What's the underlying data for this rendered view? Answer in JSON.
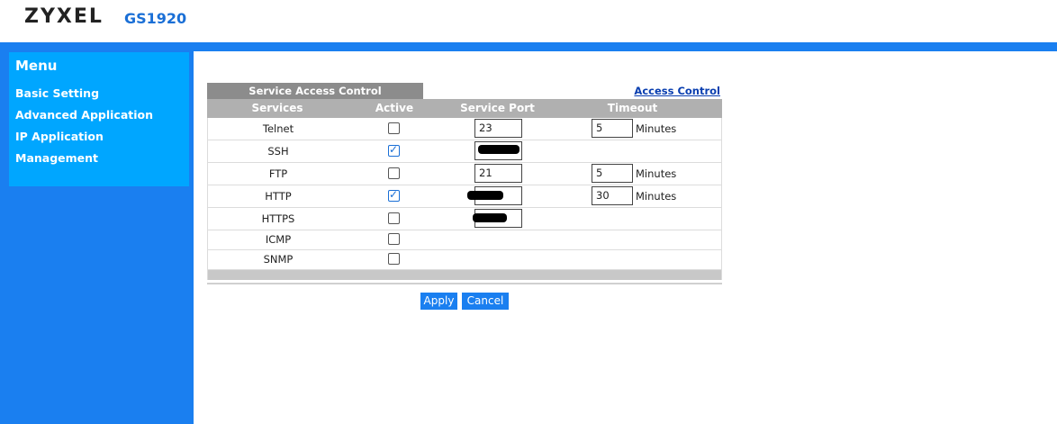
{
  "header": {
    "brand": "ZYXEL",
    "model": "GS1920"
  },
  "menu": {
    "title": "Menu",
    "items": [
      {
        "label": "Basic Setting"
      },
      {
        "label": "Advanced Application"
      },
      {
        "label": "IP Application"
      },
      {
        "label": "Management"
      }
    ]
  },
  "panel": {
    "tab": "Service Access Control",
    "link": "Access Control",
    "columns": {
      "services": "Services",
      "active": "Active",
      "port": "Service Port",
      "timeout": "Timeout"
    },
    "unit": "Minutes",
    "rows": [
      {
        "service": "Telnet",
        "active": false,
        "port": "23",
        "timeout": "5"
      },
      {
        "service": "SSH",
        "active": true,
        "port": "",
        "timeout": null
      },
      {
        "service": "FTP",
        "active": false,
        "port": "21",
        "timeout": "5"
      },
      {
        "service": "HTTP",
        "active": true,
        "port": "",
        "timeout": "30"
      },
      {
        "service": "HTTPS",
        "active": false,
        "port": "",
        "timeout": null
      },
      {
        "service": "ICMP",
        "active": false,
        "port": null,
        "timeout": null
      },
      {
        "service": "SNMP",
        "active": false,
        "port": null,
        "timeout": null
      }
    ]
  },
  "buttons": {
    "apply": "Apply",
    "cancel": "Cancel"
  }
}
